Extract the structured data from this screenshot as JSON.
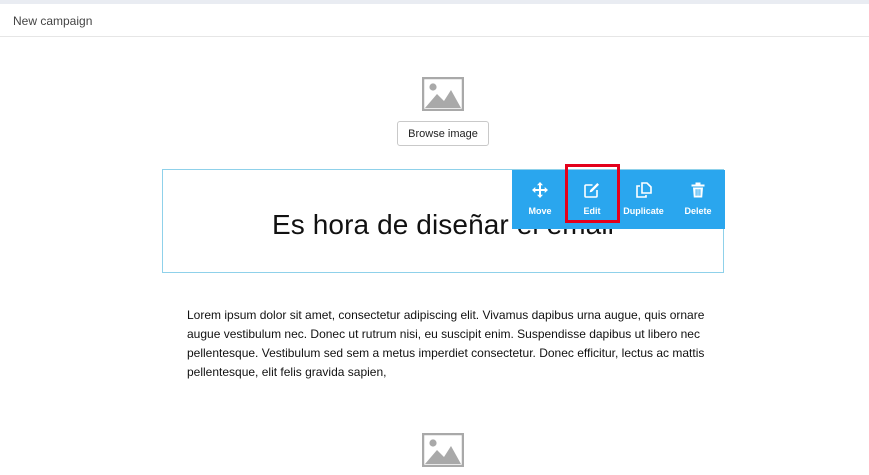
{
  "header": {
    "title": "New campaign"
  },
  "top_image": {
    "icon": "image-placeholder-icon",
    "browse_label": "Browse image"
  },
  "heading_block": {
    "text": "Es hora de diseñar el email"
  },
  "toolbar": {
    "color": "#2aa6ee",
    "items": [
      {
        "icon": "move-icon",
        "label": "Move"
      },
      {
        "icon": "edit-icon",
        "label": "Edit"
      },
      {
        "icon": "duplicate-icon",
        "label": "Duplicate"
      },
      {
        "icon": "trash-icon",
        "label": "Delete"
      }
    ]
  },
  "highlight": {
    "color": "#e3001b"
  },
  "paragraph": {
    "text": "Lorem ipsum dolor sit amet, consectetur adipiscing elit. Vivamus dapibus urna augue, quis ornare augue vestibulum nec. Donec ut rutrum nisi, eu suscipit enim. Suspendisse dapibus ut libero nec pellentesque. Vestibulum sed sem a metus imperdiet consectetur. Donec efficitur, lectus ac mattis pellentesque, elit felis gravida sapien,"
  },
  "bottom_image": {
    "icon": "image-placeholder-icon"
  }
}
